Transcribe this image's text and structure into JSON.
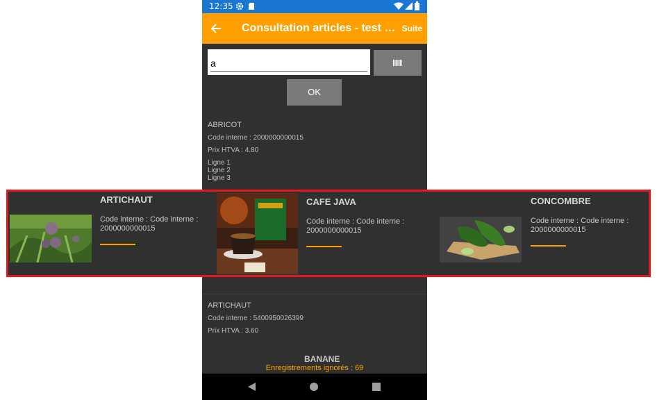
{
  "status": {
    "time": "12:35"
  },
  "appbar": {
    "title": "Consultation articles - test Suite",
    "action": "Suite"
  },
  "search": {
    "value": "a"
  },
  "ok_button": {
    "label": "OK"
  },
  "records": [
    {
      "name": "ABRICOT",
      "code": "Code interne : 2000000000015",
      "price": "Prix HTVA : 4.80",
      "lines": [
        "Ligne 1",
        "Ligne 2",
        "Ligne 3"
      ]
    },
    {
      "name": "ARTICHAUT",
      "code": "Code interne : 5400950026399",
      "price": "Prix HTVA : 3.60"
    },
    {
      "name": "BANANE"
    }
  ],
  "footer": {
    "ignored": "Enregistrements ignorés : 69"
  },
  "carousel": [
    {
      "title": "ARTICHAUT",
      "text": "Code interne : Code interne : 2000000000015",
      "image": "artichoke-image"
    },
    {
      "title": "CAFE JAVA",
      "text": "Code interne : Code interne : 2000000000015",
      "image": "coffee-image"
    },
    {
      "title": "CONCOMBRE",
      "text": "Code interne : Code interne : 2000000000015",
      "image": "cucumber-image"
    }
  ],
  "colors": {
    "accent": "#ffa000",
    "statusbar": "#1976d2",
    "background": "#303030",
    "highlight": "#e3181a"
  }
}
